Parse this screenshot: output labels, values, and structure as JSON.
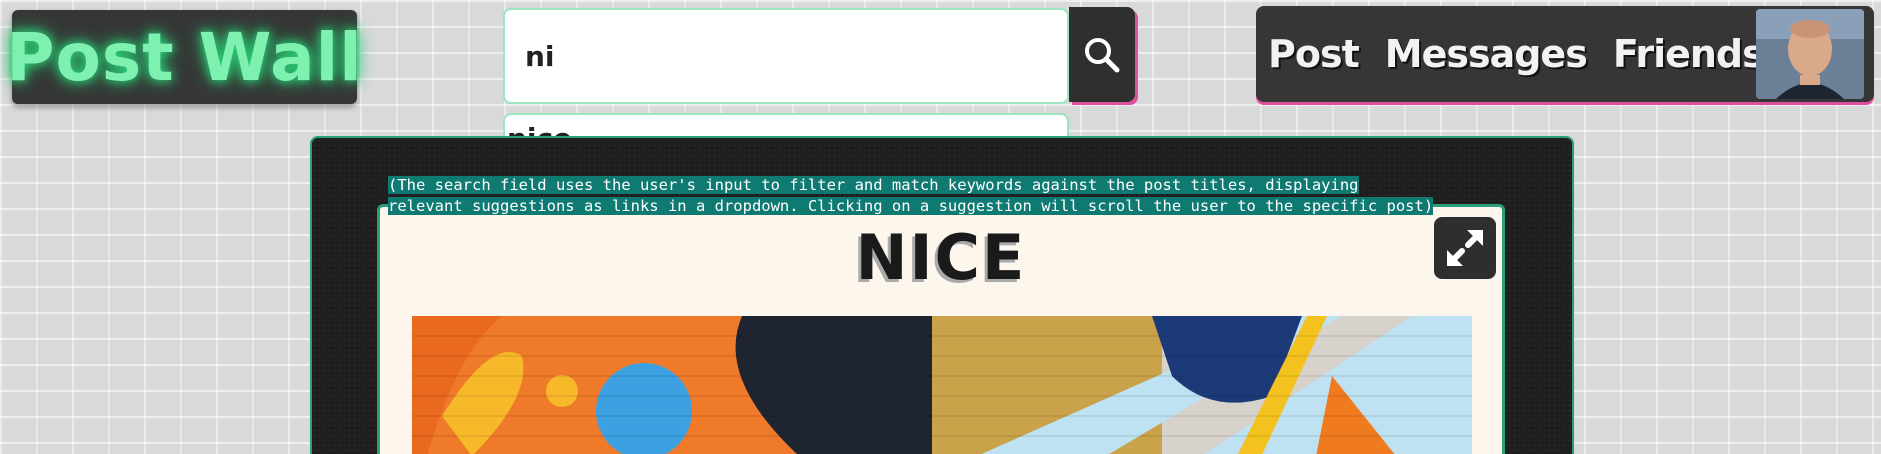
{
  "logo": {
    "text": "Post Wall"
  },
  "search": {
    "value": "ni",
    "suggestions": [
      "nice"
    ]
  },
  "nav": {
    "post": "Post",
    "messages": "Messages",
    "friends": "Friends"
  },
  "caption": {
    "line1": "(The search field uses the user's input to filter and match keywords against the post titles, displaying ",
    "line2": "relevant suggestions as links in a dropdown. Clicking on a suggestion will scroll the user to the specific post)"
  },
  "post": {
    "title": "NICE"
  },
  "colors": {
    "accent_green": "#2a9f7a",
    "neon_green": "#7ef0b0",
    "accent_pink": "#e04f9c",
    "panel_dark": "#363636",
    "card_bg": "#fdf6ec"
  },
  "icons": {
    "search": "search-icon",
    "expand": "expand-icon"
  }
}
